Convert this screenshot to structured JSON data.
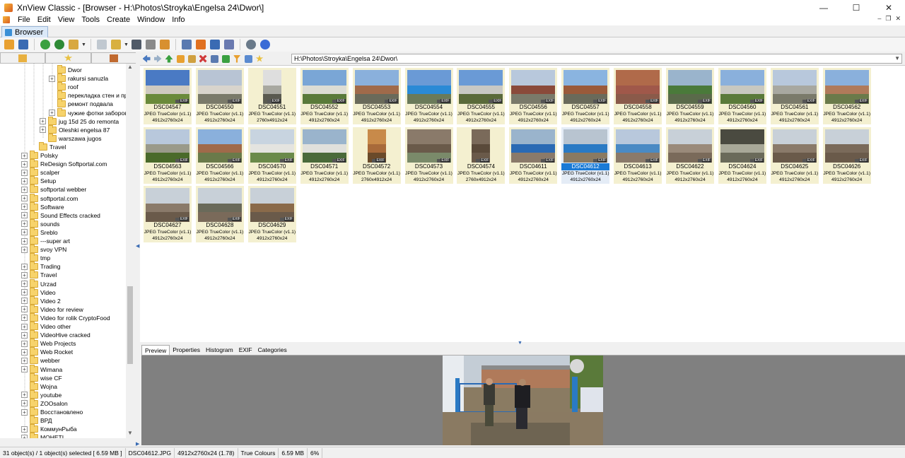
{
  "window": {
    "title": "XnView Classic - [Browser - H:\\Photos\\Stroyka\\Engelsa 24\\Dwor\\]",
    "minimize": "—",
    "maximize": "☐",
    "close": "✕"
  },
  "menu": [
    "File",
    "Edit",
    "View",
    "Tools",
    "Create",
    "Window",
    "Info"
  ],
  "mdi_buttons": [
    "–",
    "❐",
    "✕"
  ],
  "tab": {
    "label": "Browser"
  },
  "address": {
    "path": "H:\\Photos\\Stroyka\\Engelsa 24\\Dwor\\"
  },
  "tree": [
    {
      "label": "Dwor",
      "depth": 3,
      "expander": ""
    },
    {
      "label": "rakursi sanuzla",
      "depth": 3,
      "expander": "+"
    },
    {
      "label": "roof",
      "depth": 3,
      "expander": ""
    },
    {
      "label": "перекладка стен и про",
      "depth": 3,
      "expander": ""
    },
    {
      "label": "ремонт подвала",
      "depth": 3,
      "expander": ""
    },
    {
      "label": "чужие фотки заборов",
      "depth": 3,
      "expander": "+"
    },
    {
      "label": "jug 15d 25 do remonta",
      "depth": 2,
      "expander": "+"
    },
    {
      "label": "Oleshki engelsa 87",
      "depth": 2,
      "expander": "+"
    },
    {
      "label": "warszawa jugos",
      "depth": 2,
      "expander": ""
    },
    {
      "label": "Travel",
      "depth": 1,
      "expander": ""
    },
    {
      "label": "Polsky",
      "depth": 0,
      "expander": "+"
    },
    {
      "label": "ReDesign Softportal.com",
      "depth": 0,
      "expander": "+"
    },
    {
      "label": "scalper",
      "depth": 0,
      "expander": "+"
    },
    {
      "label": "Setup",
      "depth": 0,
      "expander": "+"
    },
    {
      "label": "softportal webber",
      "depth": 0,
      "expander": "+"
    },
    {
      "label": "softportal.com",
      "depth": 0,
      "expander": "+"
    },
    {
      "label": "Software",
      "depth": 0,
      "expander": "+"
    },
    {
      "label": "Sound Effects cracked",
      "depth": 0,
      "expander": "+"
    },
    {
      "label": "sounds",
      "depth": 0,
      "expander": "+"
    },
    {
      "label": "Sreblo",
      "depth": 0,
      "expander": "+"
    },
    {
      "label": "---super art",
      "depth": 0,
      "expander": "+"
    },
    {
      "label": "svoy VPN",
      "depth": 0,
      "expander": "+"
    },
    {
      "label": "tmp",
      "depth": 0,
      "expander": ""
    },
    {
      "label": "Trading",
      "depth": 0,
      "expander": "+"
    },
    {
      "label": "Travel",
      "depth": 0,
      "expander": "+"
    },
    {
      "label": "Urzad",
      "depth": 0,
      "expander": "+"
    },
    {
      "label": "Video",
      "depth": 0,
      "expander": "+"
    },
    {
      "label": "Video 2",
      "depth": 0,
      "expander": "+"
    },
    {
      "label": "Video for review",
      "depth": 0,
      "expander": "+"
    },
    {
      "label": "Video for rolik CryptoFood",
      "depth": 0,
      "expander": "+"
    },
    {
      "label": "Video other",
      "depth": 0,
      "expander": "+"
    },
    {
      "label": "VideoHive cracked",
      "depth": 0,
      "expander": "+"
    },
    {
      "label": "Web Projects",
      "depth": 0,
      "expander": "+"
    },
    {
      "label": "Web Rocket",
      "depth": 0,
      "expander": "+"
    },
    {
      "label": "webber",
      "depth": 0,
      "expander": "+"
    },
    {
      "label": "Wimana",
      "depth": 0,
      "expander": "+"
    },
    {
      "label": "wise CF",
      "depth": 0,
      "expander": ""
    },
    {
      "label": "Wojna",
      "depth": 0,
      "expander": ""
    },
    {
      "label": "youtube",
      "depth": 0,
      "expander": "+"
    },
    {
      "label": "ZOOsalon",
      "depth": 0,
      "expander": "+"
    },
    {
      "label": "Восстановлено",
      "depth": 0,
      "expander": "+"
    },
    {
      "label": "ВРД",
      "depth": 0,
      "expander": ""
    },
    {
      "label": "КоммунРыба",
      "depth": 0,
      "expander": "+"
    },
    {
      "label": "МОНЕТІ",
      "depth": 0,
      "expander": "+"
    }
  ],
  "thumbnails": [
    {
      "name": "DSC04547",
      "type": "JPEG TrueColor (v1.1)",
      "dims": "4912x2760x24",
      "palette": [
        "#4a7ac4",
        "#cfcac0",
        "#6a8a3a"
      ]
    },
    {
      "name": "DSC04550",
      "type": "JPEG TrueColor (v1.1)",
      "dims": "4912x2760x24",
      "palette": [
        "#b8c4d4",
        "#d8d4cc",
        "#7a7a6a"
      ]
    },
    {
      "name": "DSC04551",
      "type": "JPEG TrueColor (v1.1)",
      "dims": "2760x4912x24",
      "palette": [
        "#dedede",
        "#a8a8a0",
        "#5a5a50"
      ]
    },
    {
      "name": "DSC04552",
      "type": "JPEG TrueColor (v1.1)",
      "dims": "4912x2760x24",
      "palette": [
        "#7aa6d6",
        "#dcdcd4",
        "#5a7a3a"
      ]
    },
    {
      "name": "DSC04553",
      "type": "JPEG TrueColor (v1.1)",
      "dims": "4912x2760x24",
      "palette": [
        "#8ab0dc",
        "#a06a4a",
        "#6a6a5a"
      ]
    },
    {
      "name": "DSC04554",
      "type": "JPEG TrueColor (v1.1)",
      "dims": "4912x2760x24",
      "palette": [
        "#6a9ad6",
        "#2a8ad6",
        "#6a7a5a"
      ]
    },
    {
      "name": "DSC04555",
      "type": "JPEG TrueColor (v1.1)",
      "dims": "4912x2760x24",
      "palette": [
        "#6a9ad6",
        "#c8c8c4",
        "#5a6a3a"
      ]
    },
    {
      "name": "DSC04556",
      "type": "JPEG TrueColor (v1.1)",
      "dims": "4912x2760x24",
      "palette": [
        "#b8c8dc",
        "#8a4a3a",
        "#7a7a6a"
      ]
    },
    {
      "name": "DSC04557",
      "type": "JPEG TrueColor (v1.1)",
      "dims": "4912x2760x24",
      "palette": [
        "#8ab4e0",
        "#9a5a3a",
        "#6a6a5a"
      ]
    },
    {
      "name": "DSC04558",
      "type": "JPEG TrueColor (v1.1)",
      "dims": "4912x2760x24",
      "palette": [
        "#b06a4a",
        "#a0584a",
        "#8a5a4a"
      ]
    },
    {
      "name": "DSC04559",
      "type": "JPEG TrueColor (v1.1)",
      "dims": "4912x2760x24",
      "palette": [
        "#9ab4cc",
        "#4a7a3a",
        "#5a6a4a"
      ]
    },
    {
      "name": "DSC04560",
      "type": "JPEG TrueColor (v1.1)",
      "dims": "4912x2760x24",
      "palette": [
        "#8ab0dc",
        "#c8c8c0",
        "#5a7a3a"
      ]
    },
    {
      "name": "DSC04561",
      "type": "JPEG TrueColor (v1.1)",
      "dims": "4912x2760x24",
      "palette": [
        "#b8c8dc",
        "#a8a8a0",
        "#7a7a6a"
      ]
    },
    {
      "name": "DSC04562",
      "type": "JPEG TrueColor (v1.1)",
      "dims": "4912x2760x24",
      "palette": [
        "#8ab0dc",
        "#b07a5a",
        "#6a7a4a"
      ]
    },
    {
      "name": "DSC04563",
      "type": "JPEG TrueColor (v1.1)",
      "dims": "4912x2760x24",
      "palette": [
        "#b8c8dc",
        "#9a9a8a",
        "#4a6a2a"
      ]
    },
    {
      "name": "DSC04566",
      "type": "JPEG TrueColor (v1.1)",
      "dims": "4912x2760x24",
      "palette": [
        "#8ab0dc",
        "#a06a4a",
        "#6a7a4a"
      ]
    },
    {
      "name": "DSC04570",
      "type": "JPEG TrueColor (v1.1)",
      "dims": "4912x2760x24",
      "palette": [
        "#c8d4e0",
        "#e4e4e0",
        "#6a8a4a"
      ]
    },
    {
      "name": "DSC04571",
      "type": "JPEG TrueColor (v1.1)",
      "dims": "4912x2760x24",
      "palette": [
        "#9ab4cc",
        "#e0e0dc",
        "#4a6a3a"
      ]
    },
    {
      "name": "DSC04572",
      "type": "JPEG TrueColor (v1.1)",
      "dims": "2760x4912x24",
      "palette": [
        "#c88a4a",
        "#a86a3a",
        "#6a4a2a"
      ]
    },
    {
      "name": "DSC04573",
      "type": "JPEG TrueColor (v1.1)",
      "dims": "4912x2760x24",
      "palette": [
        "#8a7a6a",
        "#6a5a4a",
        "#7a8a6a"
      ]
    },
    {
      "name": "DSC04574",
      "type": "JPEG TrueColor (v1.1)",
      "dims": "2760x4912x24",
      "palette": [
        "#7a6a5a",
        "#5a4a3a",
        "#6a5a4a"
      ]
    },
    {
      "name": "DSC04611",
      "type": "JPEG TrueColor (v1.1)",
      "dims": "4912x2760x24",
      "palette": [
        "#9ab4cc",
        "#2a6ab4",
        "#8a7a6a"
      ]
    },
    {
      "name": "DSC04612",
      "type": "JPEG TrueColor (v1.1)",
      "dims": "4912x2760x24",
      "palette": [
        "#b8c4d0",
        "#2a7ac4",
        "#8a7a62"
      ],
      "selected": true
    },
    {
      "name": "DSC04613",
      "type": "JPEG TrueColor (v1.1)",
      "dims": "4912x2760x24",
      "palette": [
        "#b8c8dc",
        "#4a8ac4",
        "#8a7a6a"
      ]
    },
    {
      "name": "DSC04622",
      "type": "JPEG TrueColor (v1.1)",
      "dims": "4912x2760x24",
      "palette": [
        "#c8d0d8",
        "#9a8a7a",
        "#7a6a5a"
      ]
    },
    {
      "name": "DSC04624",
      "type": "JPEG TrueColor (v1.1)",
      "dims": "4912x2760x24",
      "palette": [
        "#4a4a40",
        "#a8a898",
        "#6a6a5a"
      ]
    },
    {
      "name": "DSC04625",
      "type": "JPEG TrueColor (v1.1)",
      "dims": "4912x2760x24",
      "palette": [
        "#c8d0d8",
        "#8a7a6a",
        "#6a5a4a"
      ]
    },
    {
      "name": "DSC04626",
      "type": "JPEG TrueColor (v1.1)",
      "dims": "4912x2760x24",
      "palette": [
        "#c8d0d8",
        "#7a6a5a",
        "#6a5a4a"
      ]
    },
    {
      "name": "DSC04627",
      "type": "JPEG TrueColor (v1.1)",
      "dims": "4912x2760x24",
      "palette": [
        "#c8d0d8",
        "#8a7a6a",
        "#6a5a4a"
      ]
    },
    {
      "name": "DSC04628",
      "type": "JPEG TrueColor (v1.1)",
      "dims": "4912x2760x24",
      "palette": [
        "#c8d0d8",
        "#6a6a5a",
        "#7a6a5a"
      ]
    },
    {
      "name": "DSC04629",
      "type": "JPEG TrueColor (v1.1)",
      "dims": "4912x2760x24",
      "palette": [
        "#c8d0d8",
        "#8a6a4a",
        "#6a5a4a"
      ]
    }
  ],
  "preview_tabs": [
    "Preview",
    "Properties",
    "Histogram",
    "EXIF",
    "Categories"
  ],
  "status": {
    "count": "31 object(s) / 1 object(s) selected  [ 6.59 MB ]",
    "file": "DSC04612.JPG",
    "dims": "4912x2760x24 (1.78)",
    "colors": "True Colours",
    "size": "6.59 MB",
    "zoom": "6%"
  },
  "colors": {
    "selection": "#1a7ad6",
    "thumb_bg": "#f4f0d0",
    "preview_bg": "#808080"
  }
}
